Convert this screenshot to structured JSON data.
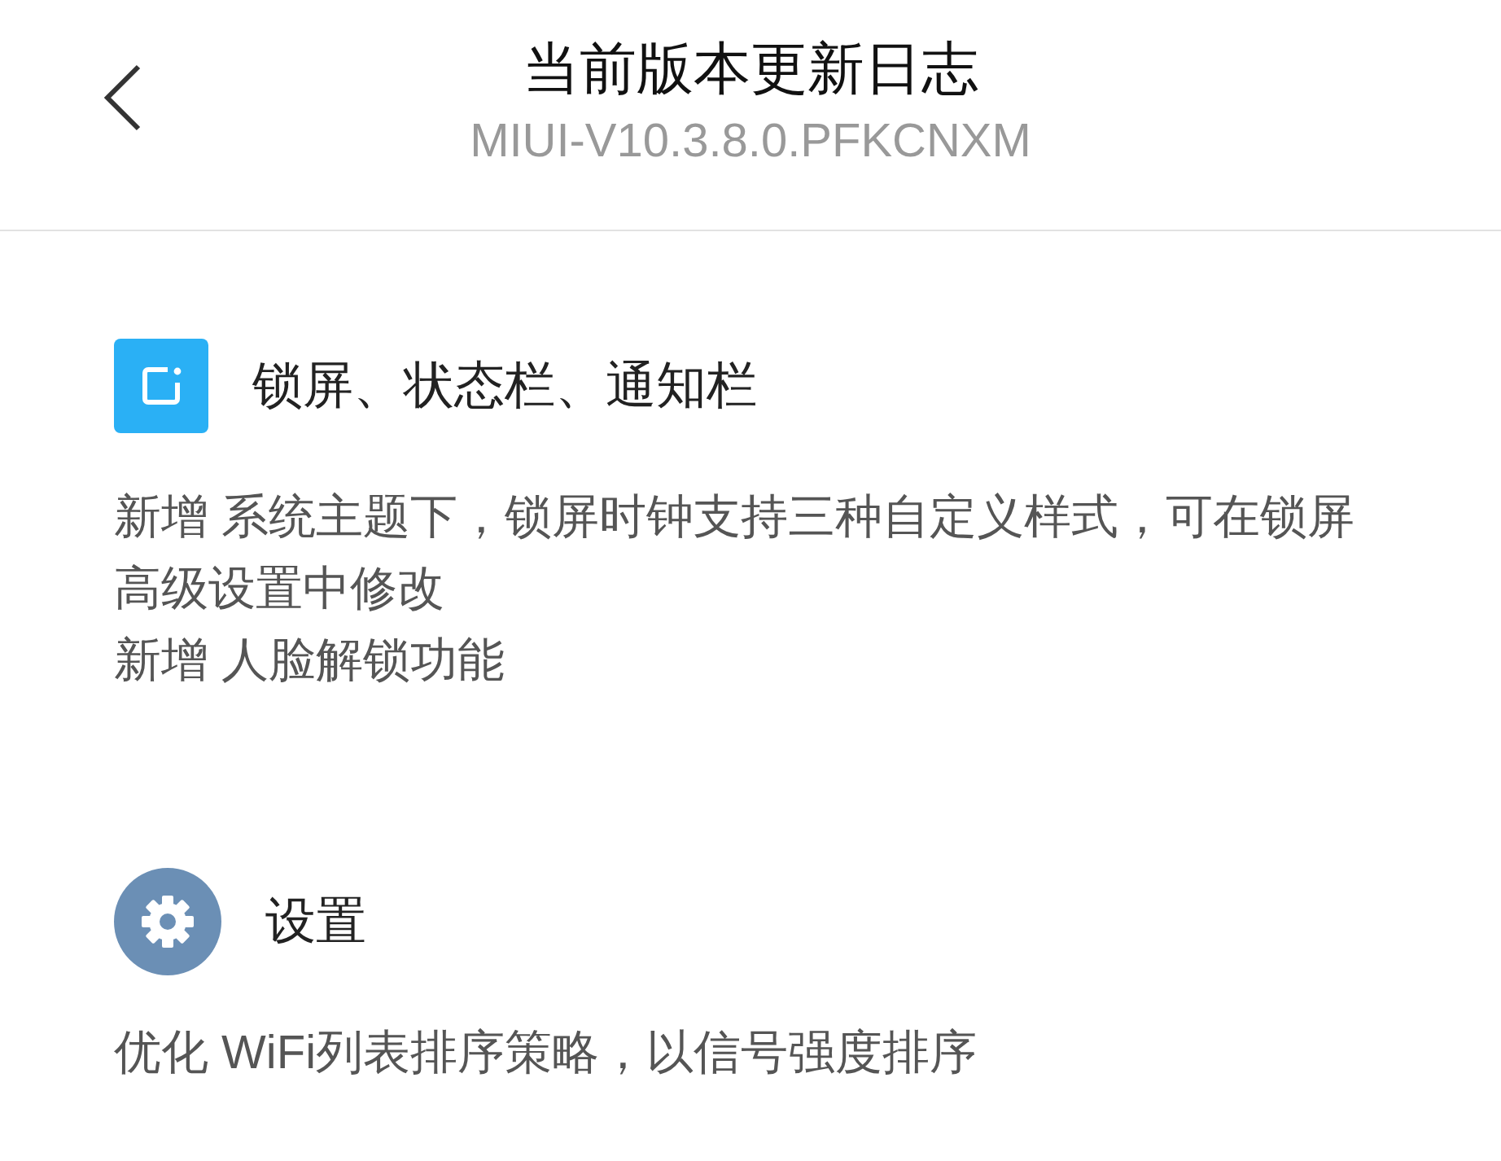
{
  "header": {
    "title": "当前版本更新日志",
    "subtitle": "MIUI-V10.3.8.0.PFKCNXM"
  },
  "sections": [
    {
      "kind": "lockscreen",
      "heading": "锁屏、状态栏、通知栏",
      "items": [
        "新增 系统主题下，锁屏时钟支持三种自定义样式，可在锁屏高级设置中修改",
        "新增 人脸解锁功能"
      ]
    },
    {
      "kind": "settings",
      "heading": "设置",
      "items": [
        "优化 WiFi列表排序策略，以信号强度排序"
      ]
    }
  ]
}
